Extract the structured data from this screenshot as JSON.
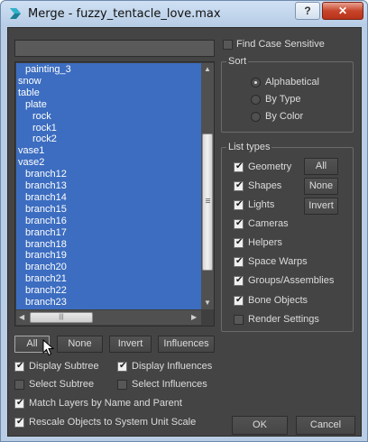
{
  "window": {
    "title": "Merge - fuzzy_tentacle_love.max",
    "help_label": "?",
    "close_label": "✕"
  },
  "filter": {
    "value": ""
  },
  "tree": {
    "items": [
      {
        "label": "painting_3",
        "indent": 1
      },
      {
        "label": "snow",
        "indent": 0
      },
      {
        "label": "table",
        "indent": 0
      },
      {
        "label": "plate",
        "indent": 1
      },
      {
        "label": "rock",
        "indent": 2
      },
      {
        "label": "rock1",
        "indent": 2
      },
      {
        "label": "rock2",
        "indent": 2
      },
      {
        "label": "vase1",
        "indent": 0
      },
      {
        "label": "vase2",
        "indent": 0
      },
      {
        "label": "branch12",
        "indent": 1
      },
      {
        "label": "branch13",
        "indent": 1
      },
      {
        "label": "branch14",
        "indent": 1
      },
      {
        "label": "branch15",
        "indent": 1
      },
      {
        "label": "branch16",
        "indent": 1
      },
      {
        "label": "branch17",
        "indent": 1
      },
      {
        "label": "branch18",
        "indent": 1
      },
      {
        "label": "branch19",
        "indent": 1
      },
      {
        "label": "branch20",
        "indent": 1
      },
      {
        "label": "branch21",
        "indent": 1
      },
      {
        "label": "branch22",
        "indent": 1
      },
      {
        "label": "branch23",
        "indent": 1
      }
    ],
    "hscroll_grip": "|||"
  },
  "find_case_sensitive": {
    "label": "Find Case Sensitive",
    "checked": false
  },
  "sort": {
    "title": "Sort",
    "options": [
      {
        "label": "Alphabetical",
        "selected": true
      },
      {
        "label": "By Type",
        "selected": false
      },
      {
        "label": "By Color",
        "selected": false
      }
    ]
  },
  "list_types": {
    "title": "List types",
    "items": [
      {
        "label": "Geometry",
        "checked": true
      },
      {
        "label": "Shapes",
        "checked": true
      },
      {
        "label": "Lights",
        "checked": true
      },
      {
        "label": "Cameras",
        "checked": true
      },
      {
        "label": "Helpers",
        "checked": true
      },
      {
        "label": "Space Warps",
        "checked": true
      },
      {
        "label": "Groups/Assemblies",
        "checked": true
      },
      {
        "label": "Bone Objects",
        "checked": true
      },
      {
        "label": "Render Settings",
        "checked": false
      }
    ],
    "buttons": {
      "all": "All",
      "none": "None",
      "invert": "Invert"
    }
  },
  "selection_buttons": {
    "all": "All",
    "none": "None",
    "invert": "Invert",
    "influences": "Influences"
  },
  "options": {
    "display_subtree": {
      "label": "Display Subtree",
      "checked": true
    },
    "display_influences": {
      "label": "Display Influences",
      "checked": true
    },
    "select_subtree": {
      "label": "Select Subtree",
      "checked": false
    },
    "select_influences": {
      "label": "Select Influences",
      "checked": false
    },
    "match_layers": {
      "label": "Match Layers by Name and Parent",
      "checked": true
    },
    "rescale_objects": {
      "label": "Rescale Objects to System Unit Scale",
      "checked": true
    }
  },
  "dialog_buttons": {
    "ok": "OK",
    "cancel": "Cancel"
  },
  "colors": {
    "selection": "#3c6dc0",
    "panel": "#444444",
    "titlebar": "#b9cde5"
  }
}
